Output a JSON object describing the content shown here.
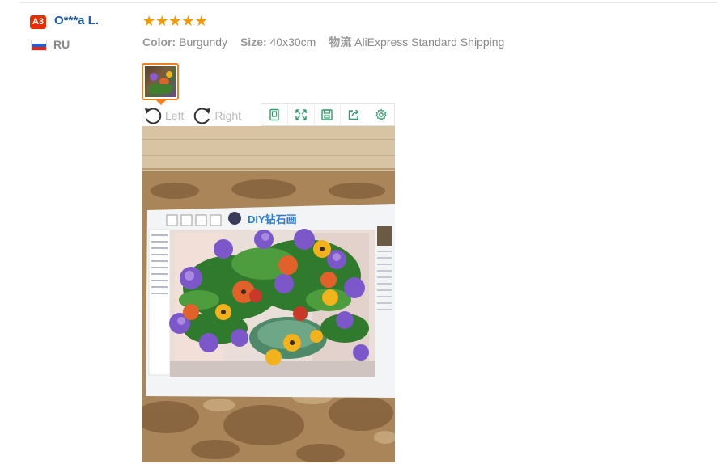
{
  "review": {
    "level_badge": "A3",
    "user_name": "O***a L.",
    "country": "RU",
    "rating": 5,
    "stars": [
      "★",
      "★",
      "★",
      "★",
      "★"
    ]
  },
  "specs": {
    "color_label": "Color:",
    "color_value": "Burgundy",
    "size_label": "Size:",
    "size_value": "40x30cm",
    "shipping_label": "物流",
    "shipping_value": "AliExpress Standard Shipping"
  },
  "image_controls": {
    "rotate_left": "Left",
    "rotate_right": "Right"
  },
  "toolbar_icons": [
    "original-size-icon",
    "fullscreen-icon",
    "save-icon",
    "share-icon",
    "settings-icon"
  ],
  "photo_text": {
    "logo": "DIY钻石画"
  },
  "colors": {
    "accent": "#f07f22",
    "name": "#1a5aa8",
    "badge": "#e62e04",
    "star": "#f39900",
    "icon_green": "#2e9e6a"
  }
}
